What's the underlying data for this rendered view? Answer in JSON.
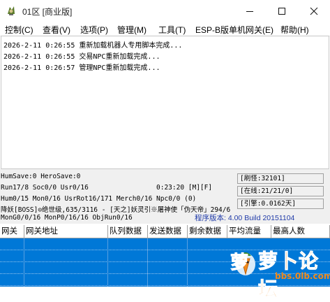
{
  "window": {
    "title": "01区 [商业版]",
    "controls": [
      "minimize",
      "maximize",
      "close"
    ]
  },
  "menu": [
    "控制(C)",
    "查看(V)",
    "选项(P)",
    "管理(M)",
    "工具(T)",
    "ESP-B版单机网关(E)",
    "帮助(H)"
  ],
  "log": [
    "2026-2-11 0:26:55 重新加载机器人专用脚本完成...",
    "2026-2-11 0:26:55 交易NPC重新加载完成...",
    "2026-2-11 0:26:57 管理NPC重新加载完成..."
  ],
  "status": {
    "hum_save": "HumSave:0 HeroSave:0",
    "run": "Run17/8 Soc0/0 Usr0/16",
    "uptime": "0:23:20 [M][F]",
    "hum": "Hum0/15 Mon0/16 UsrRot16/171 Merch0/16 Npc0/0 (0)",
    "boss": "降妖[BOSS]⊙绝世级,635/3116 - [天之]妖灵引※屠神使「伪天帝」294/6",
    "mon": "MonG0/0/16 MonP0/16/16 ObjRun0/16",
    "version": "程序版本: 4.00 Build 20151104",
    "refresh": "[刷怪:32101]",
    "online": "[在线:21/21/0]",
    "engine": "[引擎:0.0162天]"
  },
  "grid": {
    "columns": [
      "网关",
      "网关地址",
      "队列数据",
      "发送数据",
      "剩余数据",
      "平均流量",
      "最高人数"
    ]
  },
  "watermark": {
    "brand": "萝卜论坛",
    "url": "bbs.0lb.com"
  },
  "colors": {
    "selection": "#0078d7",
    "version_text": "#1f3aa8"
  }
}
